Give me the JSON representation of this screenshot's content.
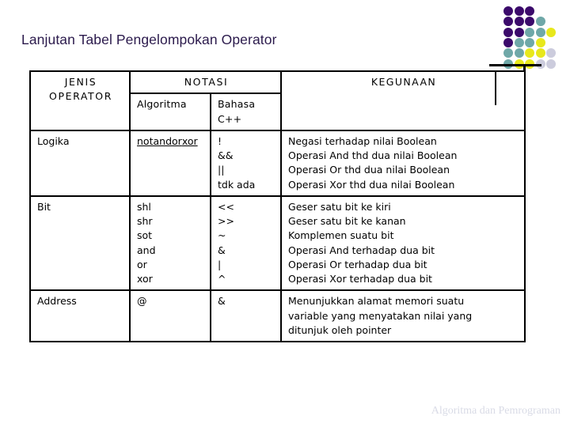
{
  "slide": {
    "title": "Lanjutan Tabel Pengelompokan Operator",
    "footer": "Algoritma dan Pemrograman",
    "title_color": "#2b1a4c",
    "footer_color": "#d9dbe6"
  },
  "decoration": {
    "name": "dot-grid",
    "colors": {
      "purple": "#3b0a6b",
      "teal": "#6fa8a8",
      "yellow": "#e8e81c",
      "lavender": "#ccccdd"
    },
    "rows": [
      [
        "purple",
        "purple",
        "purple",
        null,
        null
      ],
      [
        "purple",
        "purple",
        "purple",
        "teal",
        null
      ],
      [
        "purple",
        "purple",
        "teal",
        "teal",
        "yellow"
      ],
      [
        "purple",
        "teal",
        "teal",
        "yellow",
        null
      ],
      [
        "teal",
        "teal",
        "yellow",
        "yellow",
        "lavender"
      ],
      [
        "teal",
        "yellow",
        "yellow",
        "lavender",
        "lavender"
      ]
    ]
  },
  "table": {
    "headers": {
      "jenis_operator_line1": "JENIS",
      "jenis_operator_line2": "OPERATOR",
      "notasi": "NOTASI",
      "algoritma": "Algoritma",
      "bahasa_line1": "Bahasa",
      "bahasa_line2": "C++",
      "kegunaan": "KEGUNAAN"
    },
    "rows": [
      {
        "jenis": "Logika",
        "algoritma": [
          "not",
          "and",
          "or",
          "xor"
        ],
        "algoritma_underlined": true,
        "bahasa": [
          "!",
          "&&",
          "||",
          "tdk ada"
        ],
        "kegunaan": [
          "Negasi terhadap nilai Boolean",
          "Operasi And thd dua nilai Boolean",
          "Operasi Or thd dua nilai Boolean",
          "Operasi Xor thd dua nilai Boolean"
        ]
      },
      {
        "jenis": "Bit",
        "algoritma": [
          "shl",
          "shr",
          "sot",
          "and",
          "or",
          "xor"
        ],
        "algoritma_underlined": false,
        "bahasa": [
          "<<",
          ">>",
          "~",
          "&",
          "|",
          "^"
        ],
        "kegunaan": [
          "Geser satu bit ke kiri",
          "Geser satu bit ke kanan",
          "Komplemen suatu bit",
          "Operasi And terhadap dua bit",
          "Operasi Or terhadap dua bit",
          "Operasi Xor terhadap dua bit"
        ]
      },
      {
        "jenis": "Address",
        "algoritma": [
          "@"
        ],
        "algoritma_underlined": false,
        "bahasa": [
          "&"
        ],
        "kegunaan": [
          "Menunjukkan alamat memori suatu",
          "variable yang menyatakan nilai yang",
          "ditunjuk oleh pointer"
        ]
      }
    ]
  }
}
